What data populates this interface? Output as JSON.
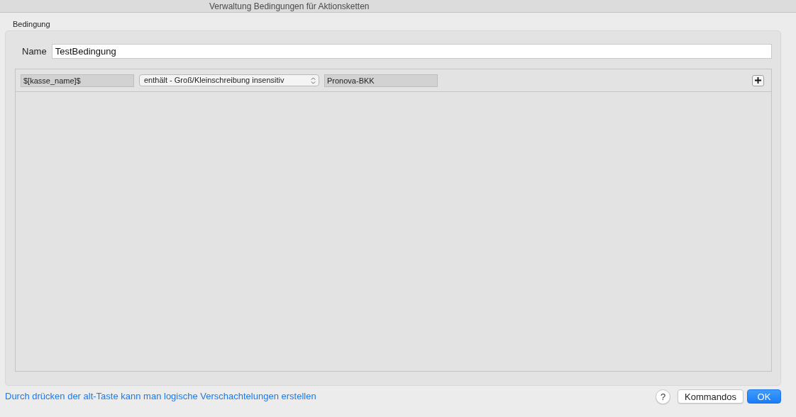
{
  "window": {
    "title": "Verwaltung Bedingungen für Aktionsketten"
  },
  "group": {
    "label": "Bedingung"
  },
  "name_field": {
    "label": "Name",
    "value": "TestBedingung"
  },
  "conditions": [
    {
      "field": "$[kasse_name]$",
      "operator": "enthält - Groß/Kleinschreibung insensitiv",
      "value": "Pronova-BKK"
    }
  ],
  "hint": "Durch drücken der alt-Taste kann man logische Verschachtelungen erstellen",
  "buttons": [
    {
      "label": "?",
      "kind": "help"
    },
    {
      "label": "Kommandos",
      "kind": "secondary"
    },
    {
      "label": "OK",
      "kind": "primary"
    }
  ]
}
